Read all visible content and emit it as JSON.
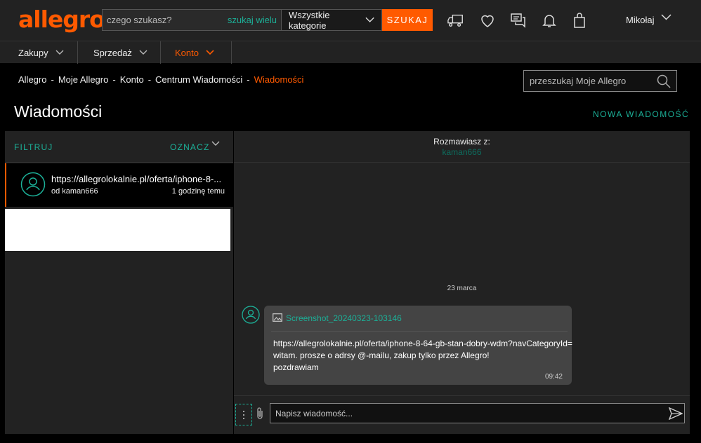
{
  "header": {
    "logo": "allegro",
    "search_placeholder": "czego szukasz?",
    "search_many": "szukaj wielu",
    "category": "Wszystkie kategorie",
    "search_button": "SZUKAJ",
    "user_name": "Mikołaj"
  },
  "nav": {
    "items": [
      {
        "label": "Zakupy"
      },
      {
        "label": "Sprzedaż"
      },
      {
        "label": "Konto"
      }
    ]
  },
  "breadcrumbs": {
    "items": [
      "Allegro",
      "Moje Allegro",
      "Konto",
      "Centrum Wiadomości"
    ],
    "separator": "-",
    "current": "Wiadomości"
  },
  "my_search": {
    "placeholder": "przeszukaj Moje Allegro"
  },
  "page": {
    "title": "Wiadomości",
    "new_message": "NOWA WIADOMOŚĆ"
  },
  "left": {
    "filter": "FILTRUJ",
    "mark": "OZNACZ",
    "threads": [
      {
        "title": "https://allegrolokalnie.pl/oferta/iphone-8-...",
        "from": "od kaman666",
        "time": "1 godzinę temu"
      }
    ]
  },
  "conversation": {
    "with_label": "Rozmawiasz z:",
    "with_user": "kaman666",
    "date": "23 marca",
    "message": {
      "attachment": "Screenshot_20240323-103146",
      "lines": [
        "https://allegrolokalnie.pl/oferta/iphone-8-64-gb-stan-dobry-wdm?navCategoryId=",
        "witam. prosze o adrsy @-mailu, zakup tylko przez Allegro!",
        "pozdrawiam"
      ],
      "time": "09:42"
    },
    "compose_placeholder": "Napisz wiadomość..."
  },
  "colors": {
    "accent": "#ff5a00",
    "teal": "#1cb098",
    "bg": "#000000",
    "panel": "#222222"
  }
}
